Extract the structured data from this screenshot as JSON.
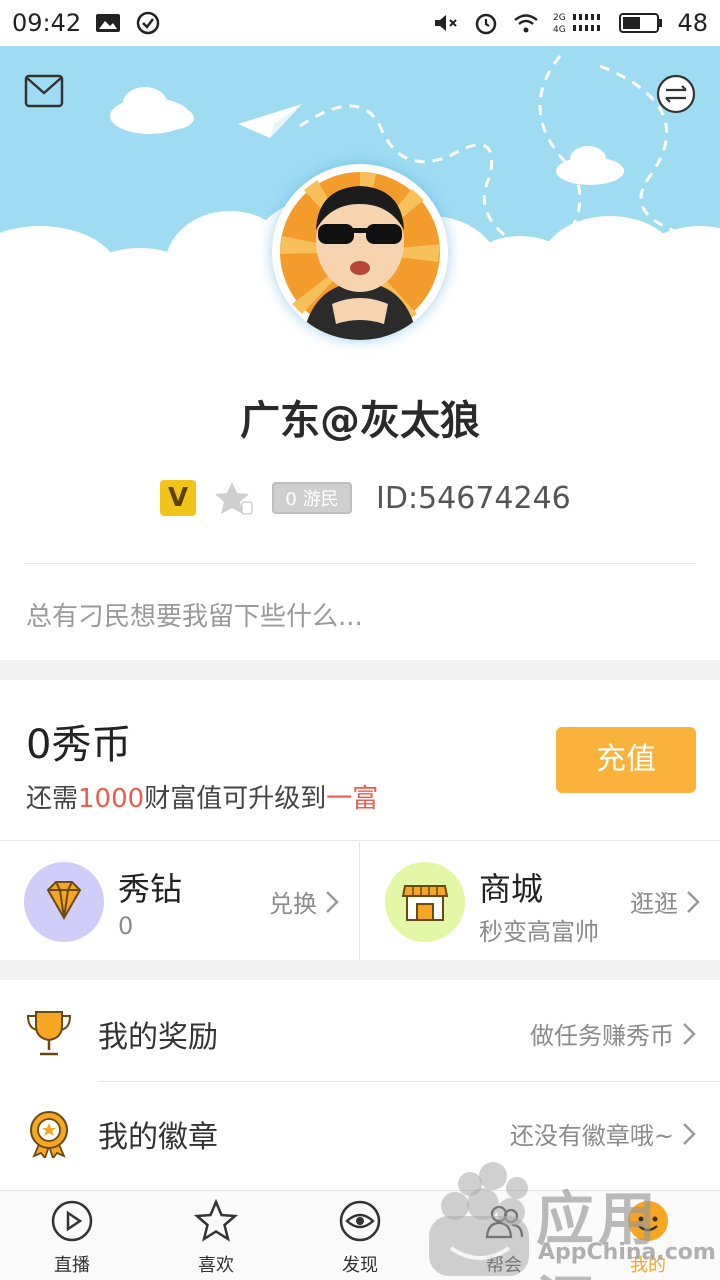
{
  "status_bar": {
    "time": "09:42",
    "battery": "48",
    "network_label_top": "2G",
    "network_label_bottom": "4G"
  },
  "profile": {
    "name": "广东@灰太狼",
    "vip_badge": "V",
    "level_badge": "0 游民",
    "id_text": "ID:54674246",
    "signature": "总有刁民想要我留下些什么..."
  },
  "wealth": {
    "coins": "0秀币",
    "upgrade_prefix": "还需",
    "upgrade_amount": "1000",
    "upgrade_middle": "财富值可升级到",
    "upgrade_target": "一富",
    "recharge_label": "充值"
  },
  "cards": [
    {
      "title": "秀钻",
      "sub": "0",
      "action": "兑换",
      "color": "#d0cdf8",
      "icon": "diamond-icon"
    },
    {
      "title": "商城",
      "sub": "秒变高富帅",
      "action": "逛逛",
      "color": "#e3f7a7",
      "icon": "shop-icon"
    }
  ],
  "menu": [
    {
      "label": "我的奖励",
      "hint": "做任务赚秀币",
      "icon": "trophy-icon"
    },
    {
      "label": "我的徽章",
      "hint": "还没有徽章哦~",
      "icon": "medal-icon"
    }
  ],
  "tabs": [
    {
      "label": "直播",
      "icon": "play-icon"
    },
    {
      "label": "喜欢",
      "icon": "star-icon"
    },
    {
      "label": "发现",
      "icon": "eye-icon"
    },
    {
      "label": "帮会",
      "icon": "group-icon"
    },
    {
      "label": "我的",
      "icon": "me-icon",
      "active": true
    }
  ],
  "watermark": {
    "text": "应用汇",
    "sub": "AppChina.com"
  },
  "colors": {
    "accent": "#fbb23a",
    "sky": "#9fdcf2",
    "red": "#ef5a4e"
  }
}
